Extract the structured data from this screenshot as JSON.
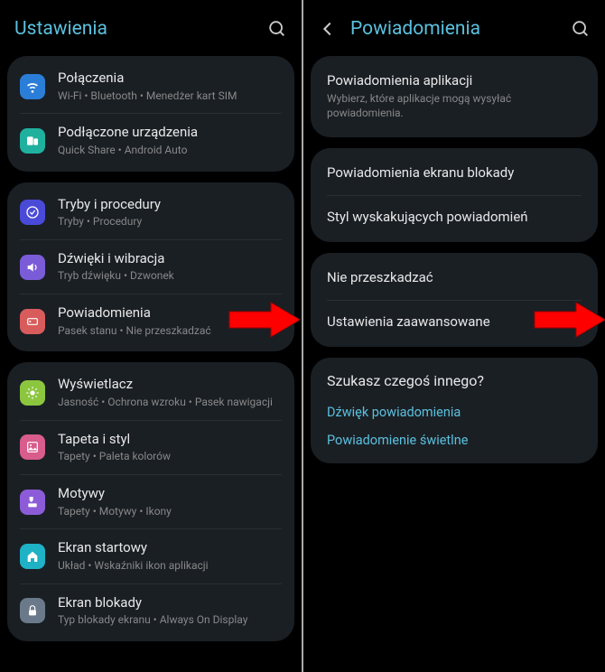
{
  "left": {
    "title": "Ustawienia",
    "groups": [
      [
        {
          "icon": "wifi",
          "color": "#2b7ed8",
          "title": "Połączenia",
          "sub": "Wi-Fi  •  Bluetooth  •  Menedżer kart SIM"
        },
        {
          "icon": "devices",
          "color": "#1fb19e",
          "title": "Podłączone urządzenia",
          "sub": "Quick Share  •  Android Auto"
        }
      ],
      [
        {
          "icon": "modes",
          "color": "#4a4ad8",
          "title": "Tryby i procedury",
          "sub": "Tryby  •  Procedury"
        },
        {
          "icon": "sound",
          "color": "#7a5cd8",
          "title": "Dźwięki i wibracja",
          "sub": "Tryb dźwięku  •  Dzwonek"
        },
        {
          "icon": "notif",
          "color": "#d85c5c",
          "title": "Powiadomienia",
          "sub": "Pasek stanu  •  Nie przeszkadzać",
          "arrow": true
        }
      ],
      [
        {
          "icon": "display",
          "color": "#8cc63f",
          "title": "Wyświetlacz",
          "sub": "Jasność  •  Ochrona wzroku  •  Pasek nawigacji"
        },
        {
          "icon": "wallpaper",
          "color": "#d85c8c",
          "title": "Tapeta i styl",
          "sub": "Tapety  •  Paleta kolorów"
        },
        {
          "icon": "themes",
          "color": "#8c5cd8",
          "title": "Motywy",
          "sub": "Tapety  •  Motywy  •  Ikony"
        },
        {
          "icon": "home",
          "color": "#1fb1c6",
          "title": "Ekran startowy",
          "sub": "Układ  •  Wskaźniki ikon aplikacji"
        },
        {
          "icon": "lock",
          "color": "#6a7a8a",
          "title": "Ekran blokady",
          "sub": "Typ blokady ekranu  •  Always On Display"
        }
      ]
    ]
  },
  "right": {
    "title": "Powiadomienia",
    "groups": [
      [
        {
          "title": "Powiadomienia aplikacji",
          "sub": "Wybierz, które aplikacje mogą wysyłać powiadomienia."
        }
      ],
      [
        {
          "title": "Powiadomienia ekranu blokady"
        },
        {
          "title": "Styl wyskakujących powiadomień"
        }
      ],
      [
        {
          "title": "Nie przeszkadzać"
        },
        {
          "title": "Ustawienia zaawansowane",
          "arrow": true
        }
      ]
    ],
    "lookingFor": {
      "title": "Szukasz czegoś innego?",
      "links": [
        "Dźwięk powiadomienia",
        "Powiadomienie świetlne"
      ]
    }
  }
}
